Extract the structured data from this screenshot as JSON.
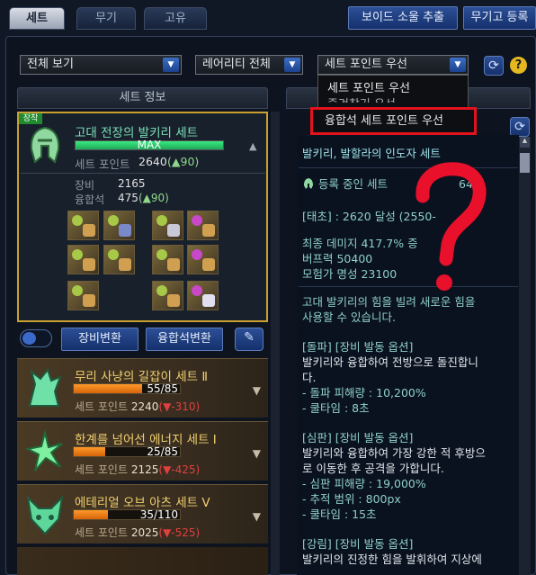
{
  "tabs": [
    {
      "label": "세트",
      "active": true
    },
    {
      "label": "무기",
      "active": false
    },
    {
      "label": "고유",
      "active": false
    }
  ],
  "top_buttons": {
    "void_soul": "보이드 소울 추출",
    "weapon_register": "무기고 등록"
  },
  "filters": {
    "view": "전체 보기",
    "rarity": "레어리티 전체",
    "sort": "세트 포인트 우선"
  },
  "sort_dropdown": {
    "options": [
      "세트 포인트 우선",
      "즐겨찾기 우선",
      "융합석 세트 포인트 우선"
    ],
    "highlighted": "융합석 세트 포인트 우선"
  },
  "left_header": "세트 정보",
  "equipped_badge": "장착",
  "selected_set": {
    "name": "고대 전장의 발키리 세트",
    "bar_label": "MAX",
    "bar_fill": 1.0,
    "set_point_label": "세트 포인트",
    "set_point_value": "2640",
    "set_point_delta": "(▲90)",
    "equip_label": "장비",
    "equip_value": "2165",
    "fusion_label": "융합석",
    "fusion_value": "475",
    "fusion_delta": "(▲90)"
  },
  "toggle_label": "",
  "buttons": {
    "equip_change": "장비변환",
    "fusion_change": "융합석변환"
  },
  "set_list": [
    {
      "name": "무리 사냥의 길잡이 세트 Ⅱ",
      "progress": "55/85",
      "progress_fill": 0.647,
      "point_label": "세트 포인트",
      "point": "2240",
      "delta": "(▼-310)"
    },
    {
      "name": "한계를 넘어선 에너지 세트 Ⅰ",
      "progress": "25/85",
      "progress_fill": 0.294,
      "point_label": "세트 포인트",
      "point": "2125",
      "delta": "(▼-425)"
    },
    {
      "name": "에테리얼 오브 아츠 세트 Ⅴ",
      "progress": "35/110",
      "progress_fill": 0.318,
      "point_label": "세트 포인트",
      "point": "2025",
      "delta": "(▼-525)"
    }
  ],
  "right_panel": {
    "title": "발키리, 발할라의 인도자 세트",
    "registered_prefix": "등록 중인 세트",
    "registered_value": "640",
    "stage": "[태초] : 2620 달성 (2550-",
    "final_damage": "최종 데미지 417.7% 증",
    "buff": "버프력 50400",
    "fame": "모험가 명성 23100",
    "desc1": "고대 발키리의 힘을 빌려 새로운 힘을",
    "desc2": "사용할 수 있습니다.",
    "opt1_head": "[돌파] [장비 발동 옵션]",
    "opt1_l1": "발키리와 융합하여 전방으로 돌진합니",
    "opt1_l2": "다.",
    "opt1_l3": "- 돌파 피해량 : 10,200%",
    "opt1_l4": "- 쿨타임 : 8초",
    "opt2_head": "[심판] [장비 발동 옵션]",
    "opt2_l1": "발키리와 융합하여 가장 강한 적 후방으",
    "opt2_l2": "로 이동한 후 공격을 가합니다.",
    "opt2_l3": "- 심판 피해량 : 19,000%",
    "opt2_l4": "- 추적 범위 : 800px",
    "opt2_l5": "- 쿨타임 : 15초",
    "opt3_head": "[강림] [장비 발동 옵션]",
    "opt3_l1": "발키리의 진정한 힘을 발휘하여 지상에"
  },
  "annotation": {
    "mark": "?",
    "color": "#e8102a"
  },
  "colors": {
    "accent_blue": "#1c428e",
    "gold_border": "#c9a030",
    "green_bar": "#2ed573",
    "orange_bar": "#ff9a2a",
    "highlight_red": "#e3121c"
  }
}
